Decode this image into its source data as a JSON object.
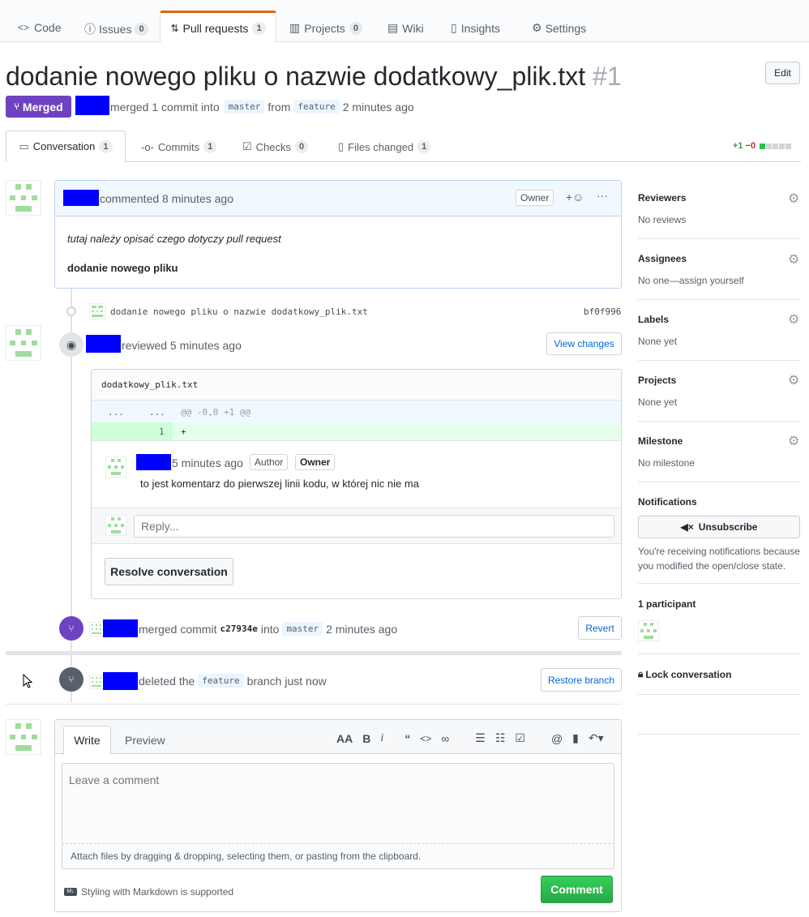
{
  "repo_nav": {
    "code": "Code",
    "issues": "Issues",
    "issues_count": "0",
    "pulls": "Pull requests",
    "pulls_count": "1",
    "projects": "Projects",
    "projects_count": "0",
    "wiki": "Wiki",
    "insights": "Insights",
    "settings": "Settings"
  },
  "pr": {
    "title": "dodanie nowego pliku o nazwie dodatkowy_plik.txt",
    "number": "#1",
    "edit": "Edit",
    "state": "Merged",
    "merged_text": "merged 1 commit into",
    "base": "master",
    "from": "from",
    "head": "feature",
    "time": "2 minutes ago"
  },
  "tabs": {
    "conversation": "Conversation",
    "conversation_count": "1",
    "commits": "Commits",
    "commits_count": "1",
    "checks": "Checks",
    "checks_count": "0",
    "files": "Files changed",
    "files_count": "1",
    "add": "+1",
    "del": "−0"
  },
  "comment": {
    "action": "commented 8 minutes ago",
    "owner": "Owner",
    "body_italic": "tutaj należy opisać czego dotyczy pull request",
    "body_bold": "dodanie nowego pliku"
  },
  "commit": {
    "message": "dodanie nowego pliku o nazwie dodatkowy_plik.txt",
    "sha": "bf0f996"
  },
  "review": {
    "action": "reviewed 5 minutes ago",
    "view_changes": "View changes",
    "file": "dodatkowy_plik.txt",
    "hunk_left": "...",
    "hunk_right": "...",
    "hunk": "@@ -0,0 +1 @@",
    "line_no": "1",
    "line": "+",
    "c_time": "5 minutes ago",
    "c_author": "Author",
    "c_owner": "Owner",
    "c_body": "to jest komentarz do pierwszej linii kodu, w której nic nie ma",
    "reply_placeholder": "Reply...",
    "resolve": "Resolve conversation"
  },
  "merge_event": {
    "text1": "merged commit",
    "sha": "c27934e",
    "text2": "into",
    "branch": "master",
    "time": "2 minutes ago",
    "revert": "Revert"
  },
  "delete_event": {
    "text1": "deleted the",
    "branch": "feature",
    "text2": "branch just now",
    "restore": "Restore branch"
  },
  "composer": {
    "write": "Write",
    "preview": "Preview",
    "placeholder": "Leave a comment",
    "attach": "Attach files by dragging & dropping, selecting them, or pasting from the clipboard.",
    "md": "Styling with Markdown is supported",
    "submit": "Comment"
  },
  "sidebar": {
    "reviewers": "Reviewers",
    "reviewers_val": "No reviews",
    "assignees": "Assignees",
    "assignees_val": "No one—assign yourself",
    "labels": "Labels",
    "labels_val": "None yet",
    "projects": "Projects",
    "projects_val": "None yet",
    "milestone": "Milestone",
    "milestone_val": "No milestone",
    "notifications": "Notifications",
    "unsubscribe": "Unsubscribe",
    "notif_text": "You're receiving notifications because you modified the open/close state.",
    "participants": "1 participant",
    "lock": "Lock conversation"
  },
  "colors": {
    "merged": "#6f42c1",
    "primary": "#2cbe4e",
    "link": "#0366d6",
    "accent_tab": "#e36209"
  }
}
